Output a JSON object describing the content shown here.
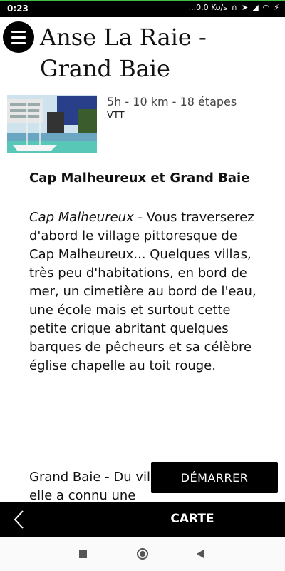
{
  "status": {
    "time": "0:23",
    "speed": "...0,0 Ko/s"
  },
  "header": {
    "title": "Anse La Raie - Grand Baie"
  },
  "route": {
    "summary": "5h - 10 km - 18 étapes",
    "type": "VTT"
  },
  "content": {
    "heading": "Cap Malheureux et Grand Baie",
    "paragraph_lead": "Cap Malheureux",
    "paragraph_rest": " - Vous traverserez d'abord le village pittoresque de Cap Malheureux... Quelques villas, très peu d'habitations, en bord de mer, un cimetière au bord de l'eau, une école mais et surtout cette petite crique abritant quelques barques de pêcheurs et sa célèbre église chapelle au toit rouge.",
    "teaser": "Grand Baie - Du village qu'il était, elle a connu une"
  },
  "actions": {
    "start_label": "DÉMARRER",
    "map_label": "CARTE"
  },
  "colors": {
    "accent_top": "#3fbf3f",
    "bar": "#000000"
  }
}
